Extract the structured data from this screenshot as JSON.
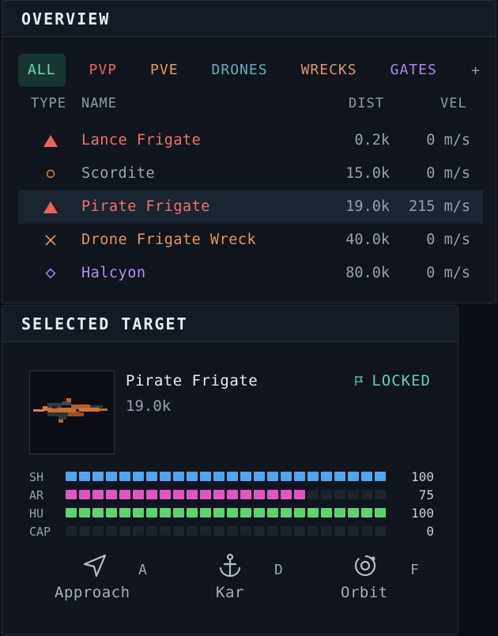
{
  "overview": {
    "title": "OVERVIEW",
    "tabs": [
      {
        "label": "ALL",
        "color": "#6fd8b8",
        "active": true
      },
      {
        "label": "PVP",
        "color": "#e8645a"
      },
      {
        "label": "PVE",
        "color": "#e89a5a"
      },
      {
        "label": "DRONES",
        "color": "#5fb3b8"
      },
      {
        "label": "WRECKS",
        "color": "#e0926a"
      },
      {
        "label": "GATES",
        "color": "#a98ae6"
      }
    ],
    "add_label": "+",
    "columns": {
      "type": "TYPE",
      "name": "NAME",
      "dist": "DIST",
      "vel": "VEL"
    },
    "rows": [
      {
        "icon": "hostile-triangle-icon",
        "name": "Lance Frigate",
        "dist": "0.2k",
        "vel": "0 m/s",
        "color": "#f0706a",
        "selected": false
      },
      {
        "icon": "asteroid-circle-icon",
        "name": "Scordite",
        "dist": "15.0k",
        "vel": "0 m/s",
        "color": "#9aa4b0",
        "selected": false
      },
      {
        "icon": "hostile-triangle-icon",
        "name": "Pirate Frigate",
        "dist": "19.0k",
        "vel": "215 m/s",
        "color": "#f0706a",
        "selected": true
      },
      {
        "icon": "wreck-cross-icon",
        "name": "Drone Frigate Wreck",
        "dist": "40.0k",
        "vel": "0 m/s",
        "color": "#e8915c",
        "selected": false
      },
      {
        "icon": "gate-diamond-icon",
        "name": "Halcyon",
        "dist": "80.0k",
        "vel": "0 m/s",
        "color": "#b38ef0",
        "selected": false
      }
    ]
  },
  "target": {
    "title": "SELECTED TARGET",
    "name": "Pirate Frigate",
    "distance": "19.0k",
    "status": "LOCKED",
    "status_icon": "flag-icon",
    "bars": [
      {
        "label": "SH",
        "value": "100",
        "fraction": 1.0,
        "color": "#4da6f0"
      },
      {
        "label": "AR",
        "value": "75",
        "fraction": 0.75,
        "color": "#e055c6"
      },
      {
        "label": "HU",
        "value": "100",
        "fraction": 1.0,
        "color": "#5ed46e"
      },
      {
        "label": "CAP",
        "value": "0",
        "fraction": 0.0,
        "color": "#4da6f0"
      }
    ],
    "actions": [
      {
        "label": "Approach",
        "key": "A",
        "icon": "navigate-arrow-icon"
      },
      {
        "label": "Kar",
        "key": "D",
        "icon": "anchor-icon"
      },
      {
        "label": "Orbit",
        "key": "F",
        "icon": "orbit-icon"
      }
    ]
  }
}
